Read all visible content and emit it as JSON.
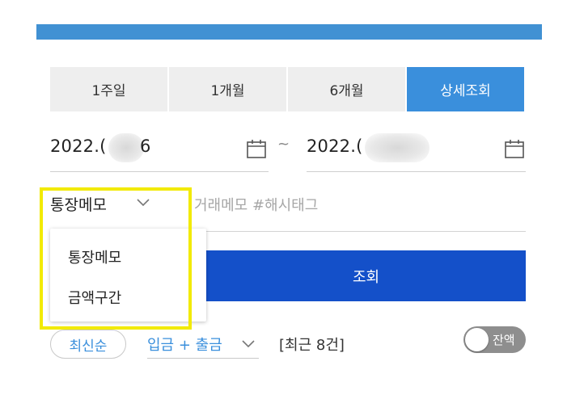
{
  "period_tabs": [
    {
      "label": "1주일",
      "active": false
    },
    {
      "label": "1개월",
      "active": false
    },
    {
      "label": "6개월",
      "active": false
    },
    {
      "label": "상세조회",
      "active": true
    }
  ],
  "date_range": {
    "start_visible": "2022.(",
    "start_suffix": "6",
    "separator": "~",
    "end_visible": "2022.("
  },
  "memo": {
    "selected_type": "통장메모",
    "placeholder": "거래메모 #해시태그",
    "options": [
      "통장메모",
      "금액구간"
    ]
  },
  "search_button_label": "조회",
  "list_controls": {
    "sort_label": "최신순",
    "type_filter": "입금 + 출금",
    "count_text": "[최근 8건]",
    "balance_toggle_label": "잔액"
  },
  "colors": {
    "accent_blue": "#3a8fdc",
    "primary_button": "#1450c9",
    "highlight_yellow": "#f2ea00"
  },
  "icons": [
    "calendar-icon",
    "chevron-down-icon"
  ]
}
